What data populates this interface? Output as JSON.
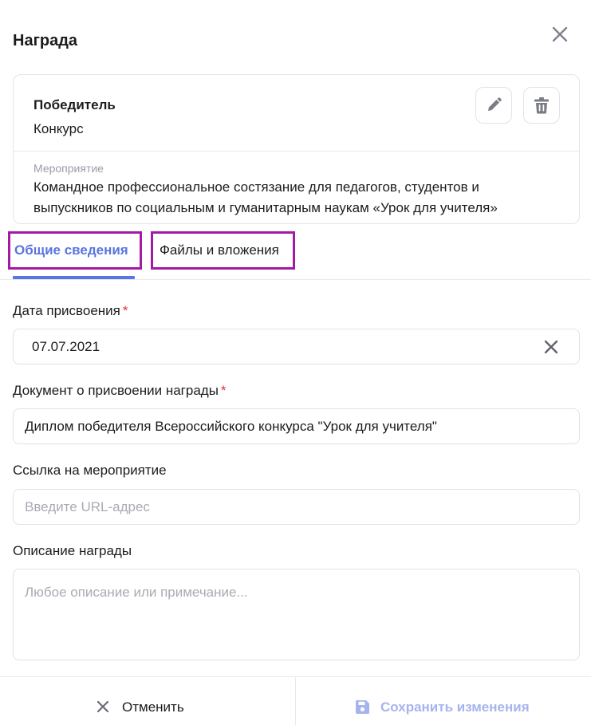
{
  "dialog": {
    "title": "Награда"
  },
  "award_card": {
    "name": "Победитель",
    "type": "Конкурс",
    "event_label": "Мероприятие",
    "event_text": "Командное профессиональное состязание для педагогов, студентов и выпускников по социальным и гуманитарным наукам «Урок для учителя»"
  },
  "tabs": [
    {
      "label": "Общие сведения",
      "active": true
    },
    {
      "label": "Файлы и вложения",
      "active": false
    }
  ],
  "form": {
    "date": {
      "label": "Дата присвоения",
      "required_mark": "*",
      "value": "07.07.2021"
    },
    "document": {
      "label": "Документ о присвоении награды",
      "required_mark": "*",
      "value": "Диплом победителя Всероссийского конкурса \"Урок для учителя\""
    },
    "link": {
      "label": "Ссылка на мероприятие",
      "placeholder": "Введите URL-адрес"
    },
    "description": {
      "label": "Описание награды",
      "placeholder": "Любое описание или примечание..."
    }
  },
  "footer": {
    "cancel_label": "Отменить",
    "save_label": "Сохранить изменения"
  },
  "colors": {
    "accent": "#5a74e0",
    "save_disabled": "#a6b4ee",
    "required": "#e0323c",
    "highlight_border": "#a31aa4"
  },
  "icons": {
    "close": "close-icon",
    "edit": "pencil-icon",
    "delete": "trash-icon",
    "clear": "clear-icon",
    "cancel": "close-icon",
    "save": "floppy-disk-icon"
  }
}
